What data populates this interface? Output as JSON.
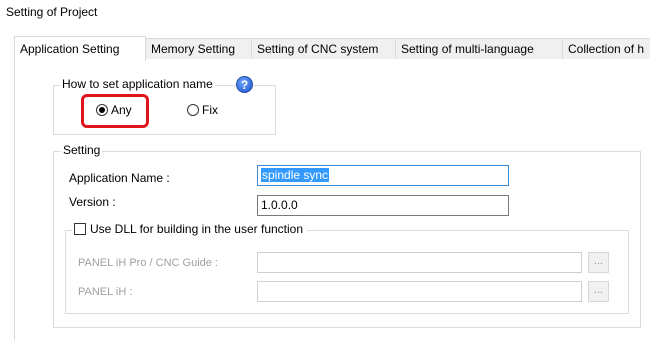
{
  "window": {
    "title": "Setting of Project"
  },
  "tabs": [
    {
      "label": "Application Setting",
      "active": true
    },
    {
      "label": "Memory Setting",
      "active": false
    },
    {
      "label": "Setting of CNC system",
      "active": false
    },
    {
      "label": "Setting of multi-language",
      "active": false
    },
    {
      "label": "Collection of h",
      "active": false
    }
  ],
  "app_name_group": {
    "legend": "How to set application name",
    "help_icon": "?",
    "options": [
      {
        "label": "Any",
        "selected": true
      },
      {
        "label": "Fix",
        "selected": false
      }
    ]
  },
  "setting_group": {
    "legend": "Setting",
    "application_name_label": "Application Name :",
    "application_name_value": "spindle sync",
    "version_label": "Version :",
    "version_value": "1.0.0.0",
    "use_dll_label": "Use DLL for building in the user function",
    "use_dll_checked": false,
    "panel_ih_pro_label": "PANEL iH Pro / CNC Guide :",
    "panel_ih_pro_value": "",
    "panel_ih_label": "PANEL iH :",
    "panel_ih_value": "",
    "browse_label": "..."
  },
  "highlight_color": "#e0151b"
}
